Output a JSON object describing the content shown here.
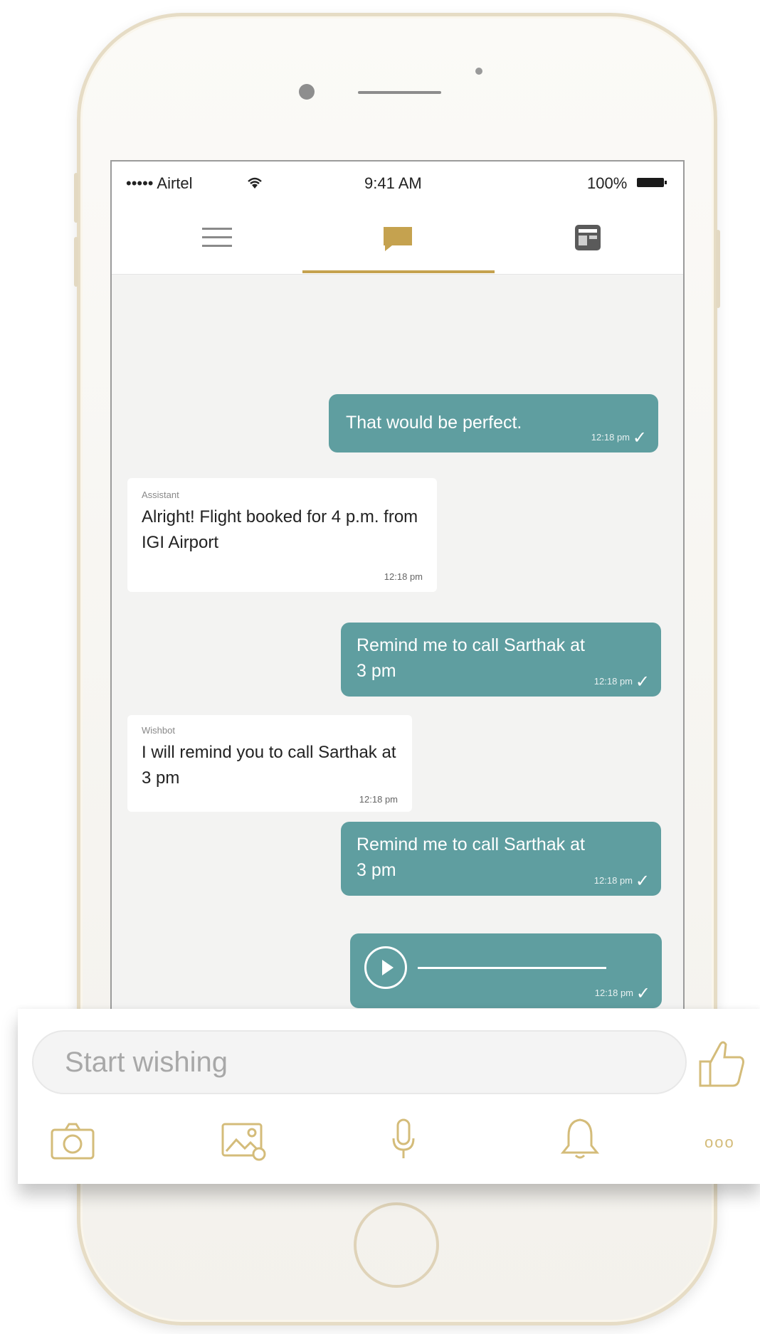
{
  "status_bar": {
    "carrier": "••••• Airtel",
    "time": "9:41 AM",
    "battery": "100%"
  },
  "nav": {
    "menu_icon": "hamburger-menu-icon",
    "chat_icon": "chat-bubble-icon",
    "card_icon": "card-icon",
    "active_tab": "chat"
  },
  "messages": [
    {
      "direction": "out",
      "text": "That would be perfect.",
      "time": "12:18 pm"
    },
    {
      "direction": "in",
      "sender": "Assistant",
      "text": "Alright! Flight booked for 4 p.m. from IGI Airport",
      "time": "12:18 pm"
    },
    {
      "direction": "out",
      "text": "Remind me to call Sarthak at 3 pm",
      "time": "12:18 pm"
    },
    {
      "direction": "in",
      "sender": "Wishbot",
      "text": "I will remind you to call Sarthak at 3 pm",
      "time": "12:18 pm"
    },
    {
      "direction": "out",
      "text": "Remind me to call Sarthak at 3 pm",
      "time": "12:18 pm"
    },
    {
      "direction": "out",
      "type": "audio",
      "time": "12:18 pm"
    }
  ],
  "input": {
    "placeholder": "Start wishing",
    "like_icon": "thumbs-up-icon"
  },
  "toolbar": {
    "icons": [
      "camera-icon",
      "image-icon",
      "microphone-icon",
      "bell-icon",
      "more-icon"
    ],
    "more_label": "ooo"
  },
  "colors": {
    "accent_gold": "#c5a24f",
    "bubble_teal": "#5f9ea0",
    "icon_gold": "#d4bc7a"
  }
}
